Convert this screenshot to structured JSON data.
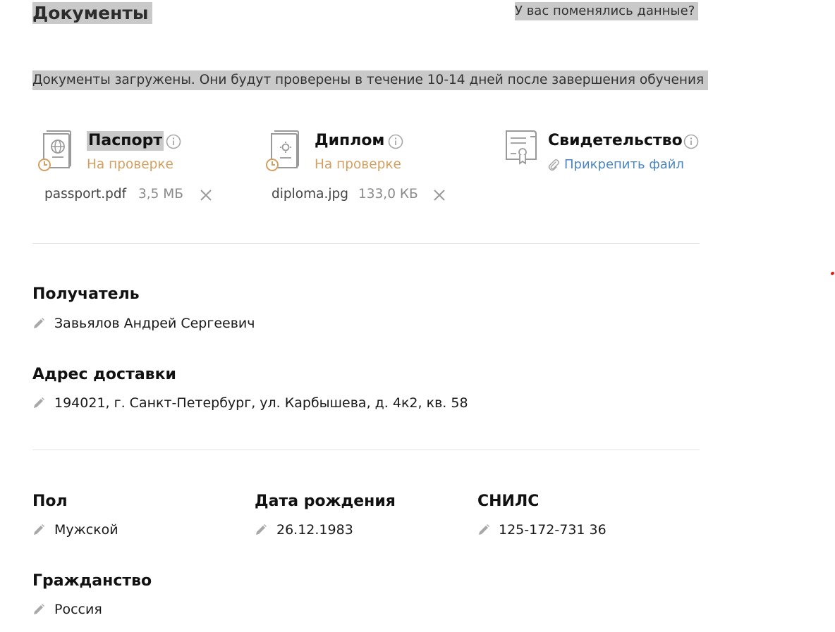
{
  "header": {
    "title": "Документы",
    "changed_link": "У вас поменялись данные?"
  },
  "notice": "Документы загружены. Они будут проверены в течение 10-14 дней после завершения обучения",
  "documents": [
    {
      "title": "Паспорт",
      "icon": "passport-icon",
      "status": "На проверке",
      "file_name": "passport.pdf",
      "file_size": "3,5 МБ"
    },
    {
      "title": "Диплом",
      "icon": "diploma-icon",
      "status": "На проверке",
      "file_name": "diploma.jpg",
      "file_size": "133,0 КБ"
    },
    {
      "title": "Свидетельство",
      "icon": "certificate-icon",
      "attach_label": "Прикрепить файл"
    }
  ],
  "recipient": {
    "label": "Получатель",
    "value": "Завьялов Андрей Сергеевич"
  },
  "delivery": {
    "label": "Адрес доставки",
    "value": "194021, г. Санкт-Петербург, ул. Карбышева, д. 4к2, кв. 58"
  },
  "personal": {
    "gender": {
      "label": "Пол",
      "value": "Мужской"
    },
    "birth_date": {
      "label": "Дата рождения",
      "value": "26.12.1983"
    },
    "snils": {
      "label": "СНИЛС",
      "value": "125-172-731 36"
    },
    "citizenship": {
      "label": "Гражданство",
      "value": "Россия"
    }
  },
  "colors": {
    "status": "#d4a060",
    "link": "#4a86c5",
    "highlight": "#c9c9c9",
    "divider": "#e3e3e3"
  }
}
